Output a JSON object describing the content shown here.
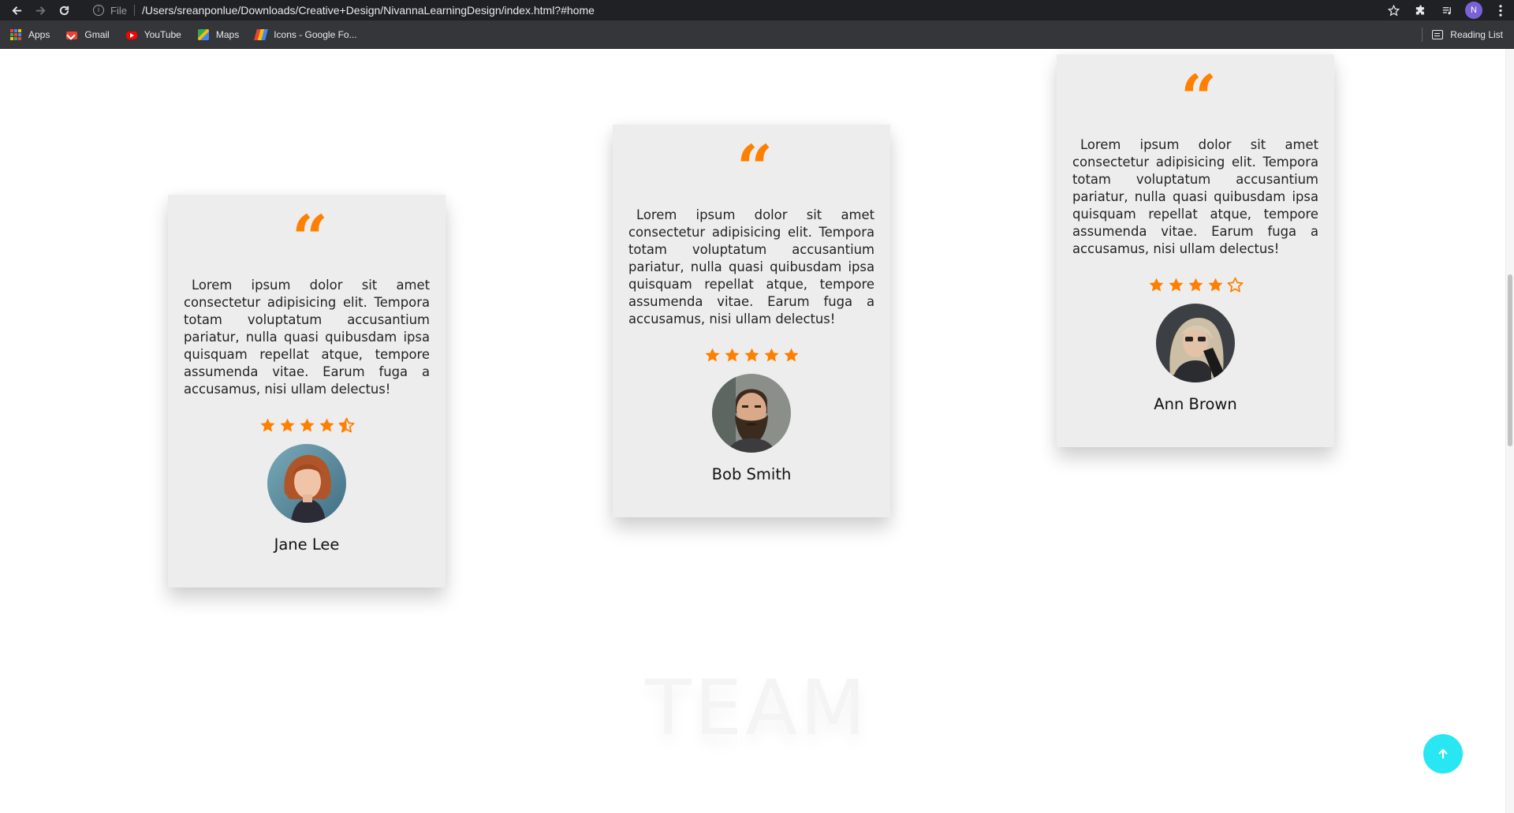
{
  "browser": {
    "url_scheme": "File",
    "url": "/Users/sreanponlue/Downloads/Creative+Design/NivannaLearningDesign/index.html?#home",
    "profile_initial": "N",
    "bookmarks": [
      {
        "label": "Apps",
        "icon": "apps-grid-icon"
      },
      {
        "label": "Gmail",
        "icon": "gmail-icon"
      },
      {
        "label": "YouTube",
        "icon": "youtube-icon"
      },
      {
        "label": "Maps",
        "icon": "maps-icon"
      },
      {
        "label": "Icons - Google Fo...",
        "icon": "google-fonts-icon"
      }
    ],
    "reading_list": "Reading List"
  },
  "testimonials": [
    {
      "review": "Lorem ipsum dolor sit amet consectetur adipisicing elit. Tempora totam voluptatum accusantium pariatur, nulla quasi quibusdam ipsa quisquam repellat atque, tempore assumenda vitae. Earum fuga a accusamus, nisi ullam delectus!",
      "rating": 4.5,
      "name": "Jane Lee"
    },
    {
      "review": "Lorem ipsum dolor sit amet consectetur adipisicing elit. Tempora totam voluptatum accusantium pariatur, nulla quasi quibusdam ipsa quisquam repellat atque, tempore assumenda vitae. Earum fuga a accusamus, nisi ullam delectus!",
      "rating": 5,
      "name": "Bob Smith"
    },
    {
      "review": "Lorem ipsum dolor sit amet consectetur adipisicing elit. Tempora totam voluptatum accusantium pariatur, nulla quasi quibusdam ipsa quisquam repellat atque, tempore assumenda vitae. Earum fuga a accusamus, nisi ullam delectus!",
      "rating": 4,
      "name": "Ann Brown"
    }
  ],
  "section_title": "TEAM",
  "colors": {
    "accent": "#ff7f00",
    "card_bg": "#ededed",
    "scroll_top_button": "#28e6f2"
  },
  "scroll_top_icon": "arrow-up-icon"
}
